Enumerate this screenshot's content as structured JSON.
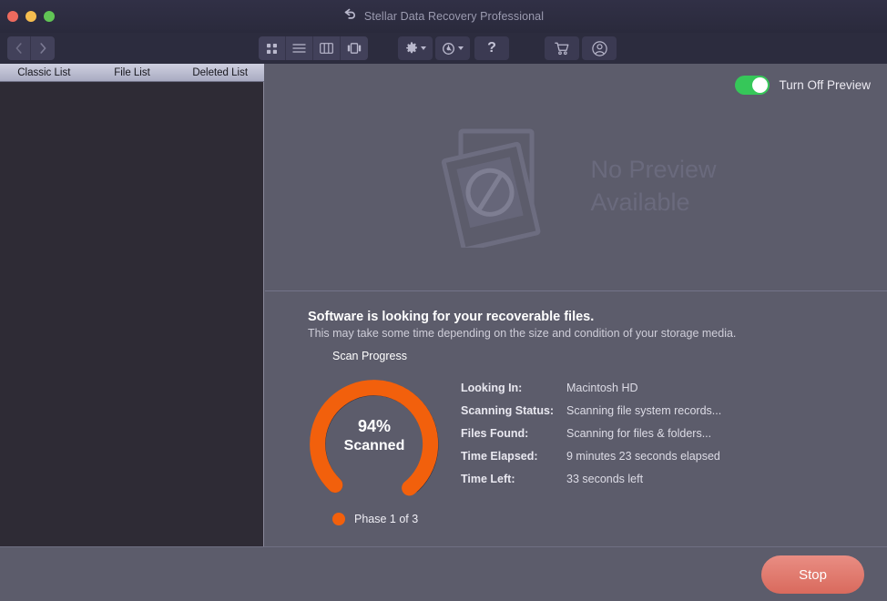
{
  "window": {
    "title": "Stellar Data Recovery Professional",
    "back_icon": "back-arrow-icon",
    "lights": [
      "close",
      "minimize",
      "zoom"
    ]
  },
  "toolbar": {
    "nav": [
      {
        "name": "back-button",
        "icon": "chevron-left-icon"
      },
      {
        "name": "forward-button",
        "icon": "chevron-right-icon"
      }
    ],
    "view_modes": [
      {
        "name": "icon-view-button",
        "icon": "grid-icon"
      },
      {
        "name": "list-view-button",
        "icon": "list-icon"
      },
      {
        "name": "column-view-button",
        "icon": "columns-icon"
      },
      {
        "name": "coverflow-view-button",
        "icon": "coverflow-icon"
      }
    ],
    "settings": {
      "name": "settings-button",
      "icon": "gear-icon",
      "has_caret": true
    },
    "history": {
      "name": "recovery-history-button",
      "icon": "clock-rewind-icon",
      "has_caret": true
    },
    "help": {
      "name": "help-button",
      "icon": "question-mark-icon",
      "label": "?"
    },
    "cart": {
      "name": "buy-button",
      "icon": "shopping-cart-icon"
    },
    "account": {
      "name": "account-button",
      "icon": "user-circle-icon"
    }
  },
  "tabs": [
    {
      "label": "Classic List",
      "selected": true
    },
    {
      "label": "File List",
      "selected": false
    },
    {
      "label": "Deleted List",
      "selected": false
    }
  ],
  "preview": {
    "toggle": {
      "label": "Turn Off Preview",
      "on": true,
      "color": "#36c759"
    },
    "placeholder_line1": "No Preview",
    "placeholder_line2": "Available",
    "placeholder_icon": "no-preview-photo-icon"
  },
  "scan": {
    "heading": "Software is looking for your recoverable files.",
    "subheading": "This may take some time depending on the size and condition of your storage media.",
    "progress_label": "Scan Progress",
    "percent_text": "94%",
    "percent_value": 94,
    "status_word": "Scanned",
    "ring_color": "#f2600c",
    "ring_track_color": "#2e2b3d",
    "details": [
      {
        "key": "Looking In:",
        "value": "Macintosh HD"
      },
      {
        "key": "Scanning Status:",
        "value": "Scanning file system records..."
      },
      {
        "key": "Files Found:",
        "value": "Scanning for files & folders..."
      },
      {
        "key": "Time Elapsed:",
        "value": "9 minutes 23 seconds elapsed"
      },
      {
        "key": "Time Left:",
        "value": "33 seconds left"
      }
    ],
    "phase": {
      "label": "Phase 1 of 3",
      "dot_color": "#f2600c"
    }
  },
  "footer": {
    "stop_label": "Stop",
    "stop_color": "#d96a5d"
  }
}
